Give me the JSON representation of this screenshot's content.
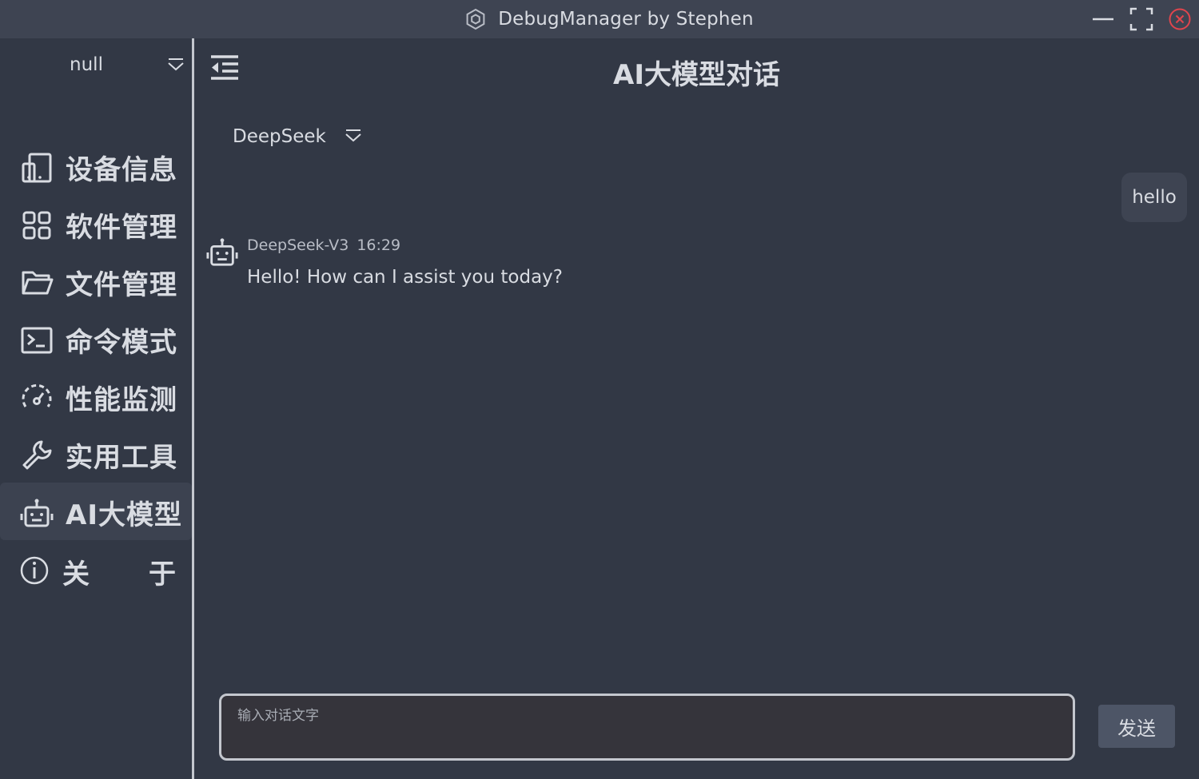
{
  "window": {
    "title": "DebugManager by Stephen",
    "icons": [
      "app-logo-icon",
      "minimize-icon",
      "maximize-icon",
      "close-icon"
    ],
    "close_color": "#e0454d"
  },
  "sidebar": {
    "device_value": "null",
    "items": [
      {
        "label": "设备信息",
        "icon": "device-icon"
      },
      {
        "label": "软件管理",
        "icon": "apps-grid-icon"
      },
      {
        "label": "文件管理",
        "icon": "folder-icon"
      },
      {
        "label": "命令模式",
        "icon": "terminal-icon"
      },
      {
        "label": "性能监测",
        "icon": "speedometer-icon"
      },
      {
        "label": "实用工具",
        "icon": "wrench-icon"
      },
      {
        "label": "AI大模型",
        "icon": "robot-icon",
        "active": true
      }
    ],
    "about": {
      "char1": "关",
      "char2": "于",
      "icon": "info-icon"
    }
  },
  "main": {
    "title": "AI大模型对话",
    "model_select": "DeepSeek",
    "messages": [
      {
        "role": "user",
        "text": "hello"
      },
      {
        "role": "assistant",
        "model": "DeepSeek-V3",
        "time": "16:29",
        "text": "Hello! How can I assist you today?"
      }
    ],
    "input_placeholder": "输入对话文字",
    "send_label": "发送"
  }
}
